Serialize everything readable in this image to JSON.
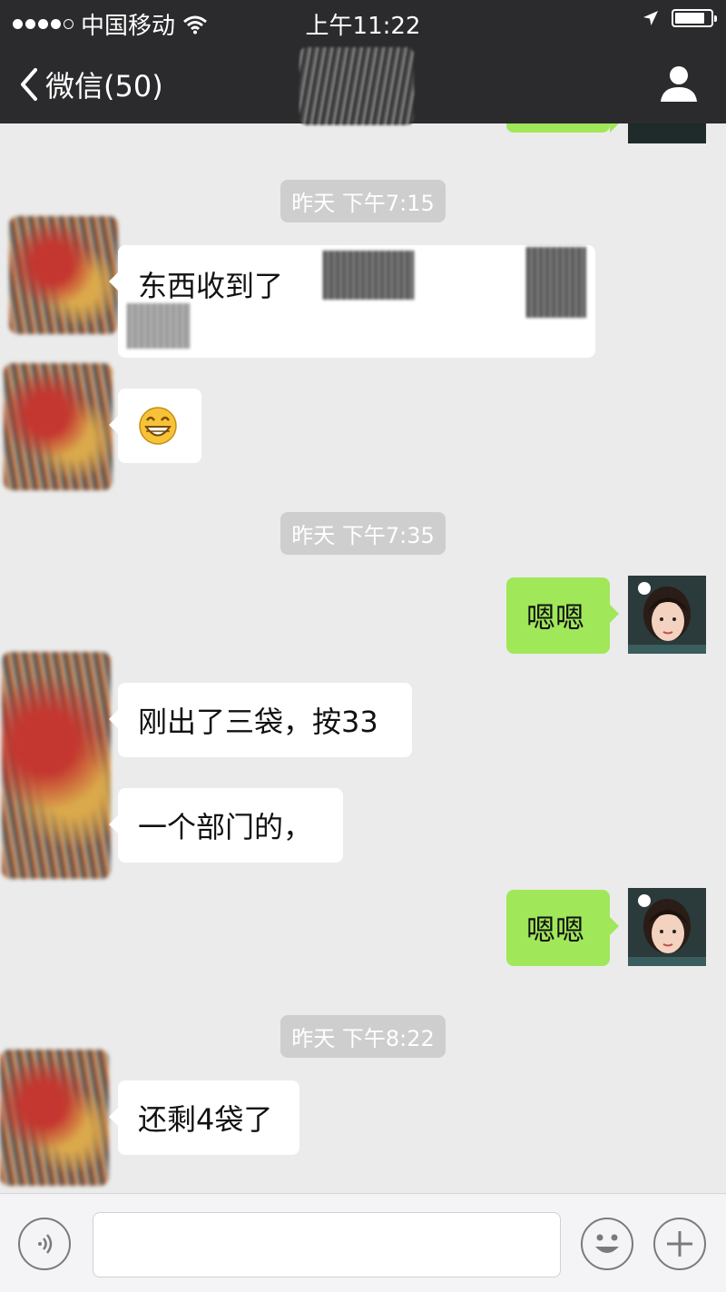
{
  "status_bar": {
    "carrier": "中国移动",
    "time": "上午11:22",
    "signal_bars": 4,
    "battery_level": 0.85
  },
  "nav": {
    "back_label": "微信(50)"
  },
  "chat": {
    "timestamps": [
      "昨天 下午7:15",
      "昨天 下午7:35",
      "昨天 下午8:22"
    ],
    "messages": [
      {
        "side": "in",
        "text": "东西收到了"
      },
      {
        "side": "in",
        "text": ""
      },
      {
        "side": "out",
        "text": "嗯嗯"
      },
      {
        "side": "in",
        "text": "刚出了三袋，按33"
      },
      {
        "side": "in",
        "text": "一个部门的，"
      },
      {
        "side": "out",
        "text": "嗯嗯"
      },
      {
        "side": "in",
        "text": "还剩4袋了"
      }
    ]
  },
  "input_bar": {
    "placeholder": ""
  },
  "colors": {
    "bar_bg": "#2b2b2d",
    "chat_bg": "#ebebeb",
    "out_bubble": "#a0e75a",
    "in_bubble": "#ffffff",
    "timestamp_bg": "#cecece"
  },
  "icons": [
    "signal-dots-icon",
    "wifi-icon",
    "location-arrow-icon",
    "battery-icon",
    "back-chevron-icon",
    "profile-icon",
    "voice-icon",
    "emoji-icon",
    "plus-icon",
    "grin-emoji-icon"
  ]
}
